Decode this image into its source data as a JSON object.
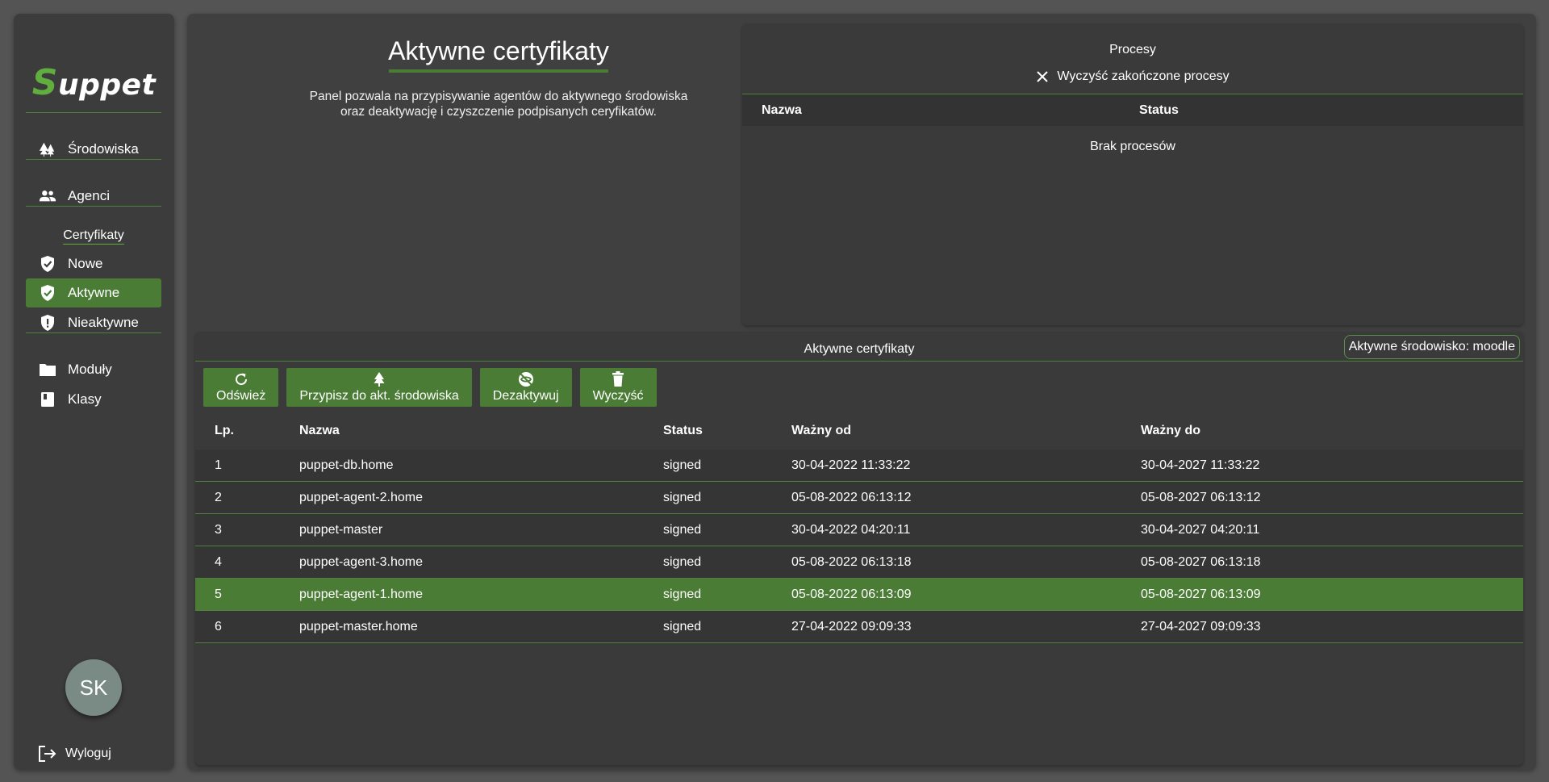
{
  "app": {
    "logo_first": "S",
    "logo_rest": "uppet"
  },
  "sidebar": {
    "items": [
      {
        "label": "Środowiska",
        "icon": "trees-icon"
      },
      {
        "label": "Agenci",
        "icon": "people-icon"
      }
    ],
    "cert_section": "Certyfikaty",
    "cert_items": [
      {
        "label": "Nowe",
        "icon": "shield-check-icon"
      },
      {
        "label": "Aktywne",
        "icon": "shield-check-icon",
        "active": true
      },
      {
        "label": "Nieaktywne",
        "icon": "shield-alert-icon"
      }
    ],
    "other_items": [
      {
        "label": "Moduły",
        "icon": "folder-icon"
      },
      {
        "label": "Klasy",
        "icon": "book-icon"
      }
    ],
    "avatar": "SK",
    "logout": "Wyloguj"
  },
  "page": {
    "title": "Aktywne certyfikaty",
    "description_line1": "Panel pozwala na przypisywanie agentów do aktywnego środowiska",
    "description_line2": "oraz deaktywację i czyszczenie podpisanych ceryfikatów."
  },
  "processes": {
    "title": "Procesy",
    "clear_label": "Wyczyść zakończone procesy",
    "columns": [
      "Nazwa",
      "Status"
    ],
    "empty": "Brak procesów"
  },
  "certs": {
    "title": "Aktywne certyfikaty",
    "env_badge": "Aktywne środowisko: moodle",
    "buttons": {
      "refresh": "Odśwież",
      "assign": "Przypisz do akt. środowiska",
      "deactivate": "Dezaktywuj",
      "clear": "Wyczyść"
    },
    "columns": [
      "Lp.",
      "Nazwa",
      "Status",
      "Ważny od",
      "Ważny do"
    ],
    "rows": [
      {
        "lp": "1",
        "name": "puppet-db.home",
        "status": "signed",
        "from": "30-04-2022 11:33:22",
        "to": "30-04-2027 11:33:22"
      },
      {
        "lp": "2",
        "name": "puppet-agent-2.home",
        "status": "signed",
        "from": "05-08-2022 06:13:12",
        "to": "05-08-2027 06:13:12"
      },
      {
        "lp": "3",
        "name": "puppet-master",
        "status": "signed",
        "from": "30-04-2022 04:20:11",
        "to": "30-04-2027 04:20:11"
      },
      {
        "lp": "4",
        "name": "puppet-agent-3.home",
        "status": "signed",
        "from": "05-08-2022 06:13:18",
        "to": "05-08-2027 06:13:18"
      },
      {
        "lp": "5",
        "name": "puppet-agent-1.home",
        "status": "signed",
        "from": "05-08-2022 06:13:09",
        "to": "05-08-2027 06:13:09",
        "selected": true
      },
      {
        "lp": "6",
        "name": "puppet-master.home",
        "status": "signed",
        "from": "27-04-2022 09:09:33",
        "to": "27-04-2027 09:09:33"
      }
    ]
  },
  "colors": {
    "accent": "#4a7c36",
    "logo_accent": "#5fae3e",
    "background": "#545454",
    "panel": "#3c3c3c"
  }
}
